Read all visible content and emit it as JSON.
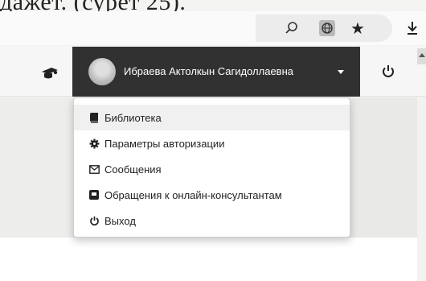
{
  "document": {
    "caption_fragment": "дажет. (сурет 25)."
  },
  "browser": {
    "icons": [
      "zoom-icon",
      "globe-icon",
      "star-icon",
      "download-icon"
    ]
  },
  "header": {
    "user_name": "Ибраева Актолкын Сагидоллаевна",
    "logo_icon": "hat-icon",
    "power_icon": "power-icon",
    "toggle_color": "#313131"
  },
  "dropdown": {
    "items": [
      {
        "label": "Библиотека",
        "icon": "book-icon",
        "active": true
      },
      {
        "label": "Параметры авторизации",
        "icon": "gear-icon",
        "active": false
      },
      {
        "label": "Сообщения",
        "icon": "envelope-icon",
        "active": false
      },
      {
        "label": "Обращения к онлайн-консультантам",
        "icon": "chat-icon",
        "active": false
      },
      {
        "label": "Выход",
        "icon": "power-icon",
        "active": false
      }
    ]
  }
}
